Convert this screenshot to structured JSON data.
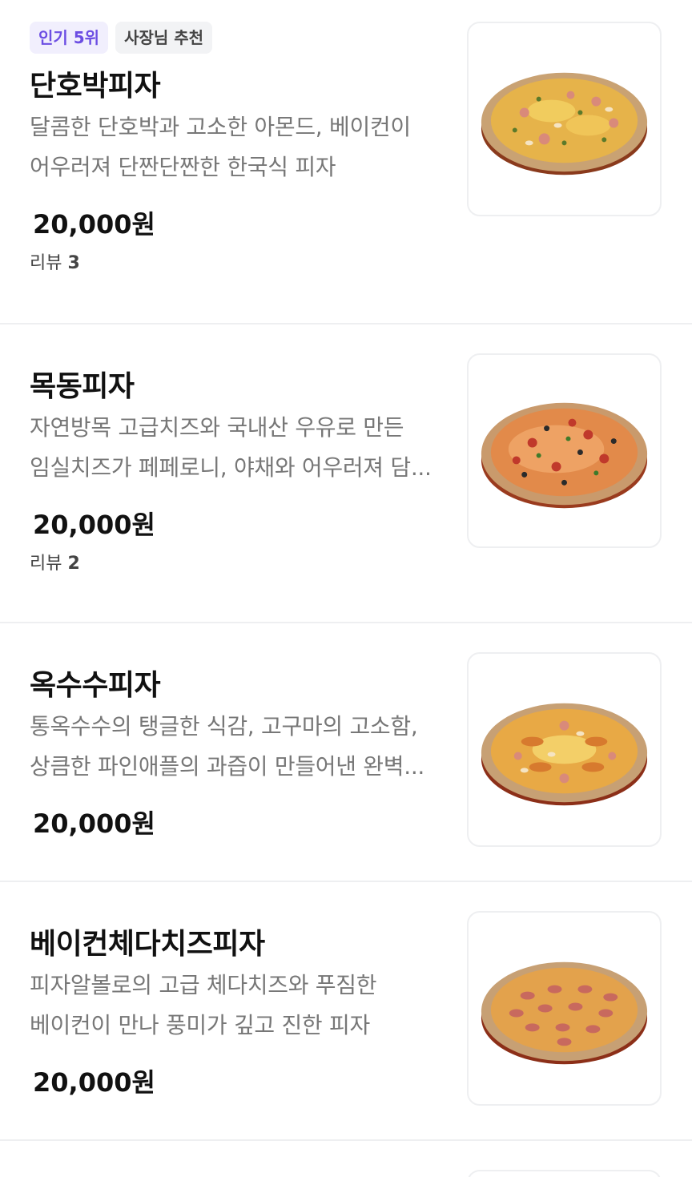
{
  "menu": {
    "items": [
      {
        "badges": [
          "인기 5위",
          "사장님 추천"
        ],
        "name": "단호박피자",
        "desc_lines": [
          "달콤한 단호박과 고소한 아몬드, 베이컨이",
          "어우러져 단짠단짠한 한국식 피자"
        ],
        "price": "20,000원",
        "review_label": "리뷰",
        "review_count": "3",
        "image_icon": "pizza-sweet-pumpkin-image"
      },
      {
        "name": "목동피자",
        "desc_lines": [
          "자연방목 고급치즈와 국내산 우유로 만든",
          "임실치즈가 페페로니, 야채와 어우러져 담..."
        ],
        "price": "20,000원",
        "review_label": "리뷰",
        "review_count": "2",
        "image_icon": "pizza-mokdong-image"
      },
      {
        "name": "옥수수피자",
        "desc_lines": [
          "통옥수수의 탱글한 식감, 고구마의 고소함,",
          "상큼한 파인애플의 과즙이 만들어낸 완벽..."
        ],
        "price": "20,000원",
        "image_icon": "pizza-corn-image"
      },
      {
        "name": "베이컨체다치즈피자",
        "desc_lines": [
          "피자알볼로의 고급 체다치즈와 푸짐한",
          "베이컨이 만나 풍미가 깊고 진한 피자"
        ],
        "price": "20,000원",
        "image_icon": "pizza-bacon-cheddar-image"
      }
    ]
  },
  "colors": {
    "badge_popular_text": "#6c4ee3",
    "badge_popular_bg": "#f1effd",
    "badge_owner_bg": "#f2f3f5",
    "divider": "#eeeff1",
    "description_text": "#777777"
  }
}
